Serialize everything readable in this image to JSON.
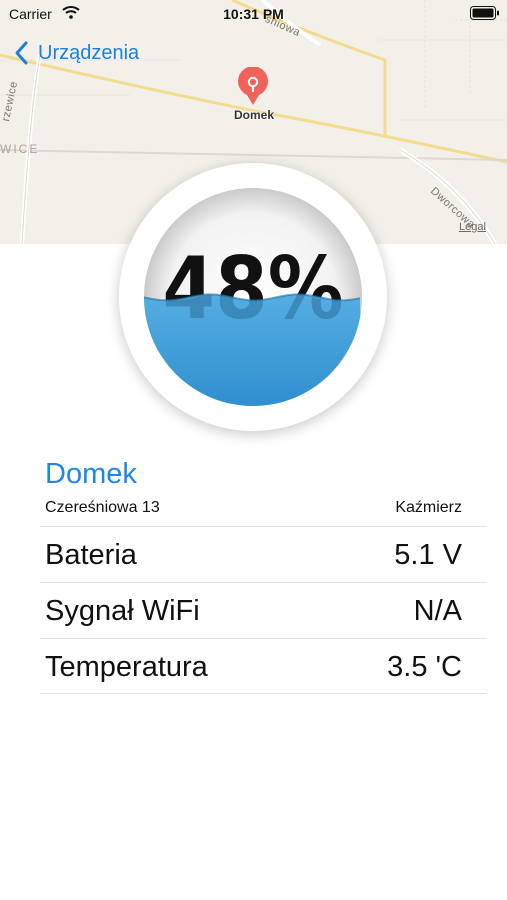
{
  "status_bar": {
    "carrier": "Carrier",
    "time": "10:31 PM"
  },
  "nav": {
    "back_label": "Urządzenia"
  },
  "map": {
    "pin_label": "Domek",
    "street_dworcowa": "Dworcowa",
    "street_sniowa": "śniowa",
    "street_left": "rzewice",
    "district_label": "WICE",
    "legal": "Legal"
  },
  "gauge": {
    "percent_text": "48%",
    "level": 0.48
  },
  "device": {
    "name": "Domek",
    "address": "Czereśniowa 13",
    "city": "Kaźmierz"
  },
  "rows": [
    {
      "label": "Bateria",
      "value": "5.1 V"
    },
    {
      "label": "Sygnał WiFi",
      "value": "N/A"
    },
    {
      "label": "Temperatura",
      "value": "3.5 'C"
    }
  ],
  "colors": {
    "accent": "#1a7fe3",
    "water": "#3f9fd8",
    "pin": "#f0635a"
  }
}
